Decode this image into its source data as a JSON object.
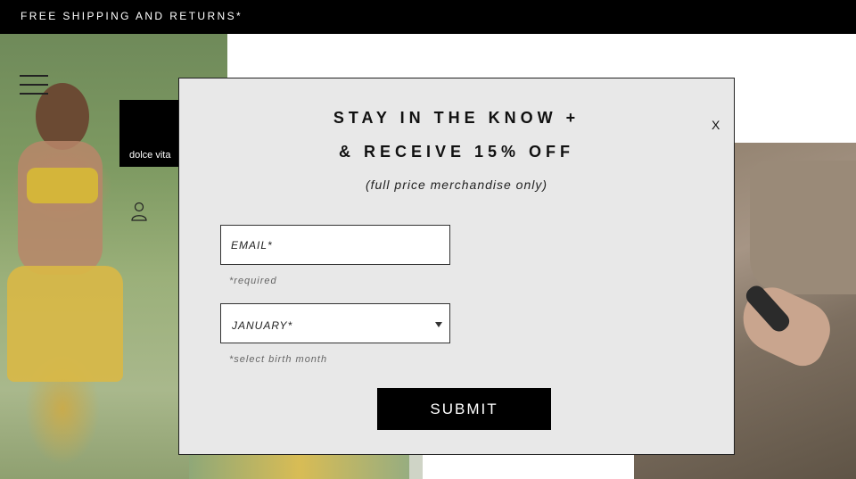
{
  "promo_bar": {
    "text": "FREE SHIPPING AND RETURNS*"
  },
  "brand": {
    "logo_text": "dolce vita"
  },
  "modal": {
    "close_label": "X",
    "headline_line1": "STAY IN THE KNOW +",
    "headline_line2": "& RECEIVE 15% OFF",
    "subline": "(full price merchandise only)",
    "email": {
      "placeholder": "EMAIL*",
      "value": "",
      "hint": "*required"
    },
    "birth_month": {
      "selected": "JANUARY*",
      "hint": "*select birth month"
    },
    "submit_label": "SUBMIT"
  },
  "colors": {
    "bar_bg": "#000000",
    "modal_bg": "#e8e8e8",
    "button_bg": "#000000",
    "button_text": "#ffffff"
  },
  "icons": [
    "hamburger-menu-icon",
    "account-icon",
    "chevron-down-icon"
  ]
}
